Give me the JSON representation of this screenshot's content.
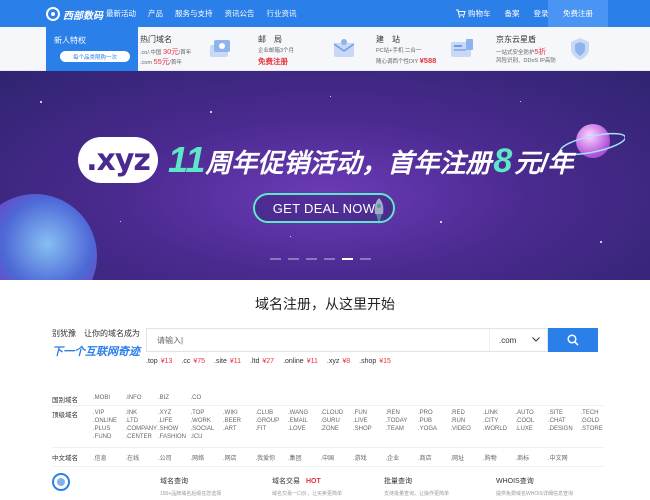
{
  "brand": {
    "logo_text": "西部数码",
    "accent": "#2b7fe9"
  },
  "topnav": {
    "left_items": [
      "最新活动",
      "产品",
      "服务与支持",
      "资讯公告",
      "行业资讯"
    ],
    "cart_label": "购物车",
    "filing_label": "备案",
    "login_label": "登录",
    "register_label": "免费注册"
  },
  "promo_strip": {
    "newbie": {
      "title": "新人特权",
      "pill": "每个品类限购一次"
    },
    "promos": [
      {
        "title": "热门域名",
        "line1_a": ".cn/.中国",
        "line1_price": "30元",
        "line1_b": "/首年",
        "line2_a": ".com",
        "line2_price": "55元",
        "line2_b": "/首年"
      },
      {
        "title": "邮　局",
        "line1": "企业邮箱3个月",
        "line2": "免费注册"
      },
      {
        "title": "建　站",
        "line1": "PC站+手机 二合一",
        "line2_a": "随心调西个性DIY",
        "line2_price": "¥588"
      },
      {
        "title": "京东云星盾",
        "line1_a": "一站式安全防护",
        "line1_price": "5折",
        "line2": "风险识别、DDoS IP高防"
      }
    ]
  },
  "banner": {
    "badge": ".xyz",
    "num": "11",
    "text_a": "周年促销活动，首年注册",
    "price": "8",
    "text_b": "元/年",
    "button": "GET DEAL NOW"
  },
  "search": {
    "section_title": "域名注册，从这里开始",
    "slogan_line1": "别犹豫　让你的域名成为",
    "slogan_line2": "下一个互联网奇迹",
    "placeholder": "请输入|",
    "tld_selected": ".com",
    "prices": [
      {
        "tld": ".top",
        "price": "¥13"
      },
      {
        "tld": ".cc",
        "price": "¥75"
      },
      {
        "tld": ".site",
        "price": "¥11"
      },
      {
        "tld": ".ltd",
        "price": "¥27"
      },
      {
        "tld": ".online",
        "price": "¥11"
      },
      {
        "tld": ".xyz",
        "price": "¥8"
      },
      {
        "tld": ".shop",
        "price": "¥15"
      }
    ]
  },
  "domain_lists": {
    "country": {
      "label": "国别域名",
      "tlds": [
        ".MOBI",
        ".INFO",
        ".BIZ",
        ".CO"
      ]
    },
    "top_level": {
      "label": "顶级域名",
      "tlds": [
        ".VIP",
        ".INK",
        ".XYZ",
        ".TOP",
        ".WIKI",
        ".CLUB",
        ".WANG",
        ".CLOUD",
        ".FUN",
        ".REN",
        ".PRO",
        ".RED",
        ".LINK",
        ".AUTO",
        ".SITE",
        ".TECH",
        ".ONLINE",
        ".LTD",
        ".LIFE",
        ".WORK",
        ".BEER",
        ".GROUP",
        ".EMAIL",
        ".GURU",
        ".LIVE",
        ".TODAY",
        ".PUB",
        ".RUN",
        ".CITY",
        ".COOL",
        ".CHAT",
        ".GOLD",
        ".PLUS",
        ".COMPANY",
        ".SHOW",
        ".SOCIAL",
        ".ART",
        ".FIT",
        ".LOVE",
        ".ZONE",
        ".SHOP",
        ".TEAM",
        ".YOGA",
        ".VIDEO",
        ".WORLD",
        ".LUXE",
        ".DESIGN",
        ".STORE",
        ".FUND",
        ".CENTER",
        ".FASHION",
        ".ICU"
      ]
    },
    "chinese": {
      "label": "中文域名",
      "tlds": [
        ".信息",
        ".在线",
        ".公司",
        ".网络",
        ".网店",
        ".我爱你",
        ".集团",
        ".中国",
        ".游戏",
        ".企业",
        ".商店",
        ".网址",
        ".购物",
        ".商标",
        ".中文网"
      ]
    }
  },
  "services": [
    {
      "title": "域名查询",
      "desc": "150+品牌域名后缀任您选择"
    },
    {
      "title": "域名交易",
      "hot": "HOT",
      "desc": "域名交易一口价，让买卖更简单"
    },
    {
      "title": "批量查询",
      "desc": "支持批量查询，让操作更简单"
    },
    {
      "title": "WHOIS查询",
      "desc": "提供免费域名WHOIS详细信息查询"
    }
  ]
}
